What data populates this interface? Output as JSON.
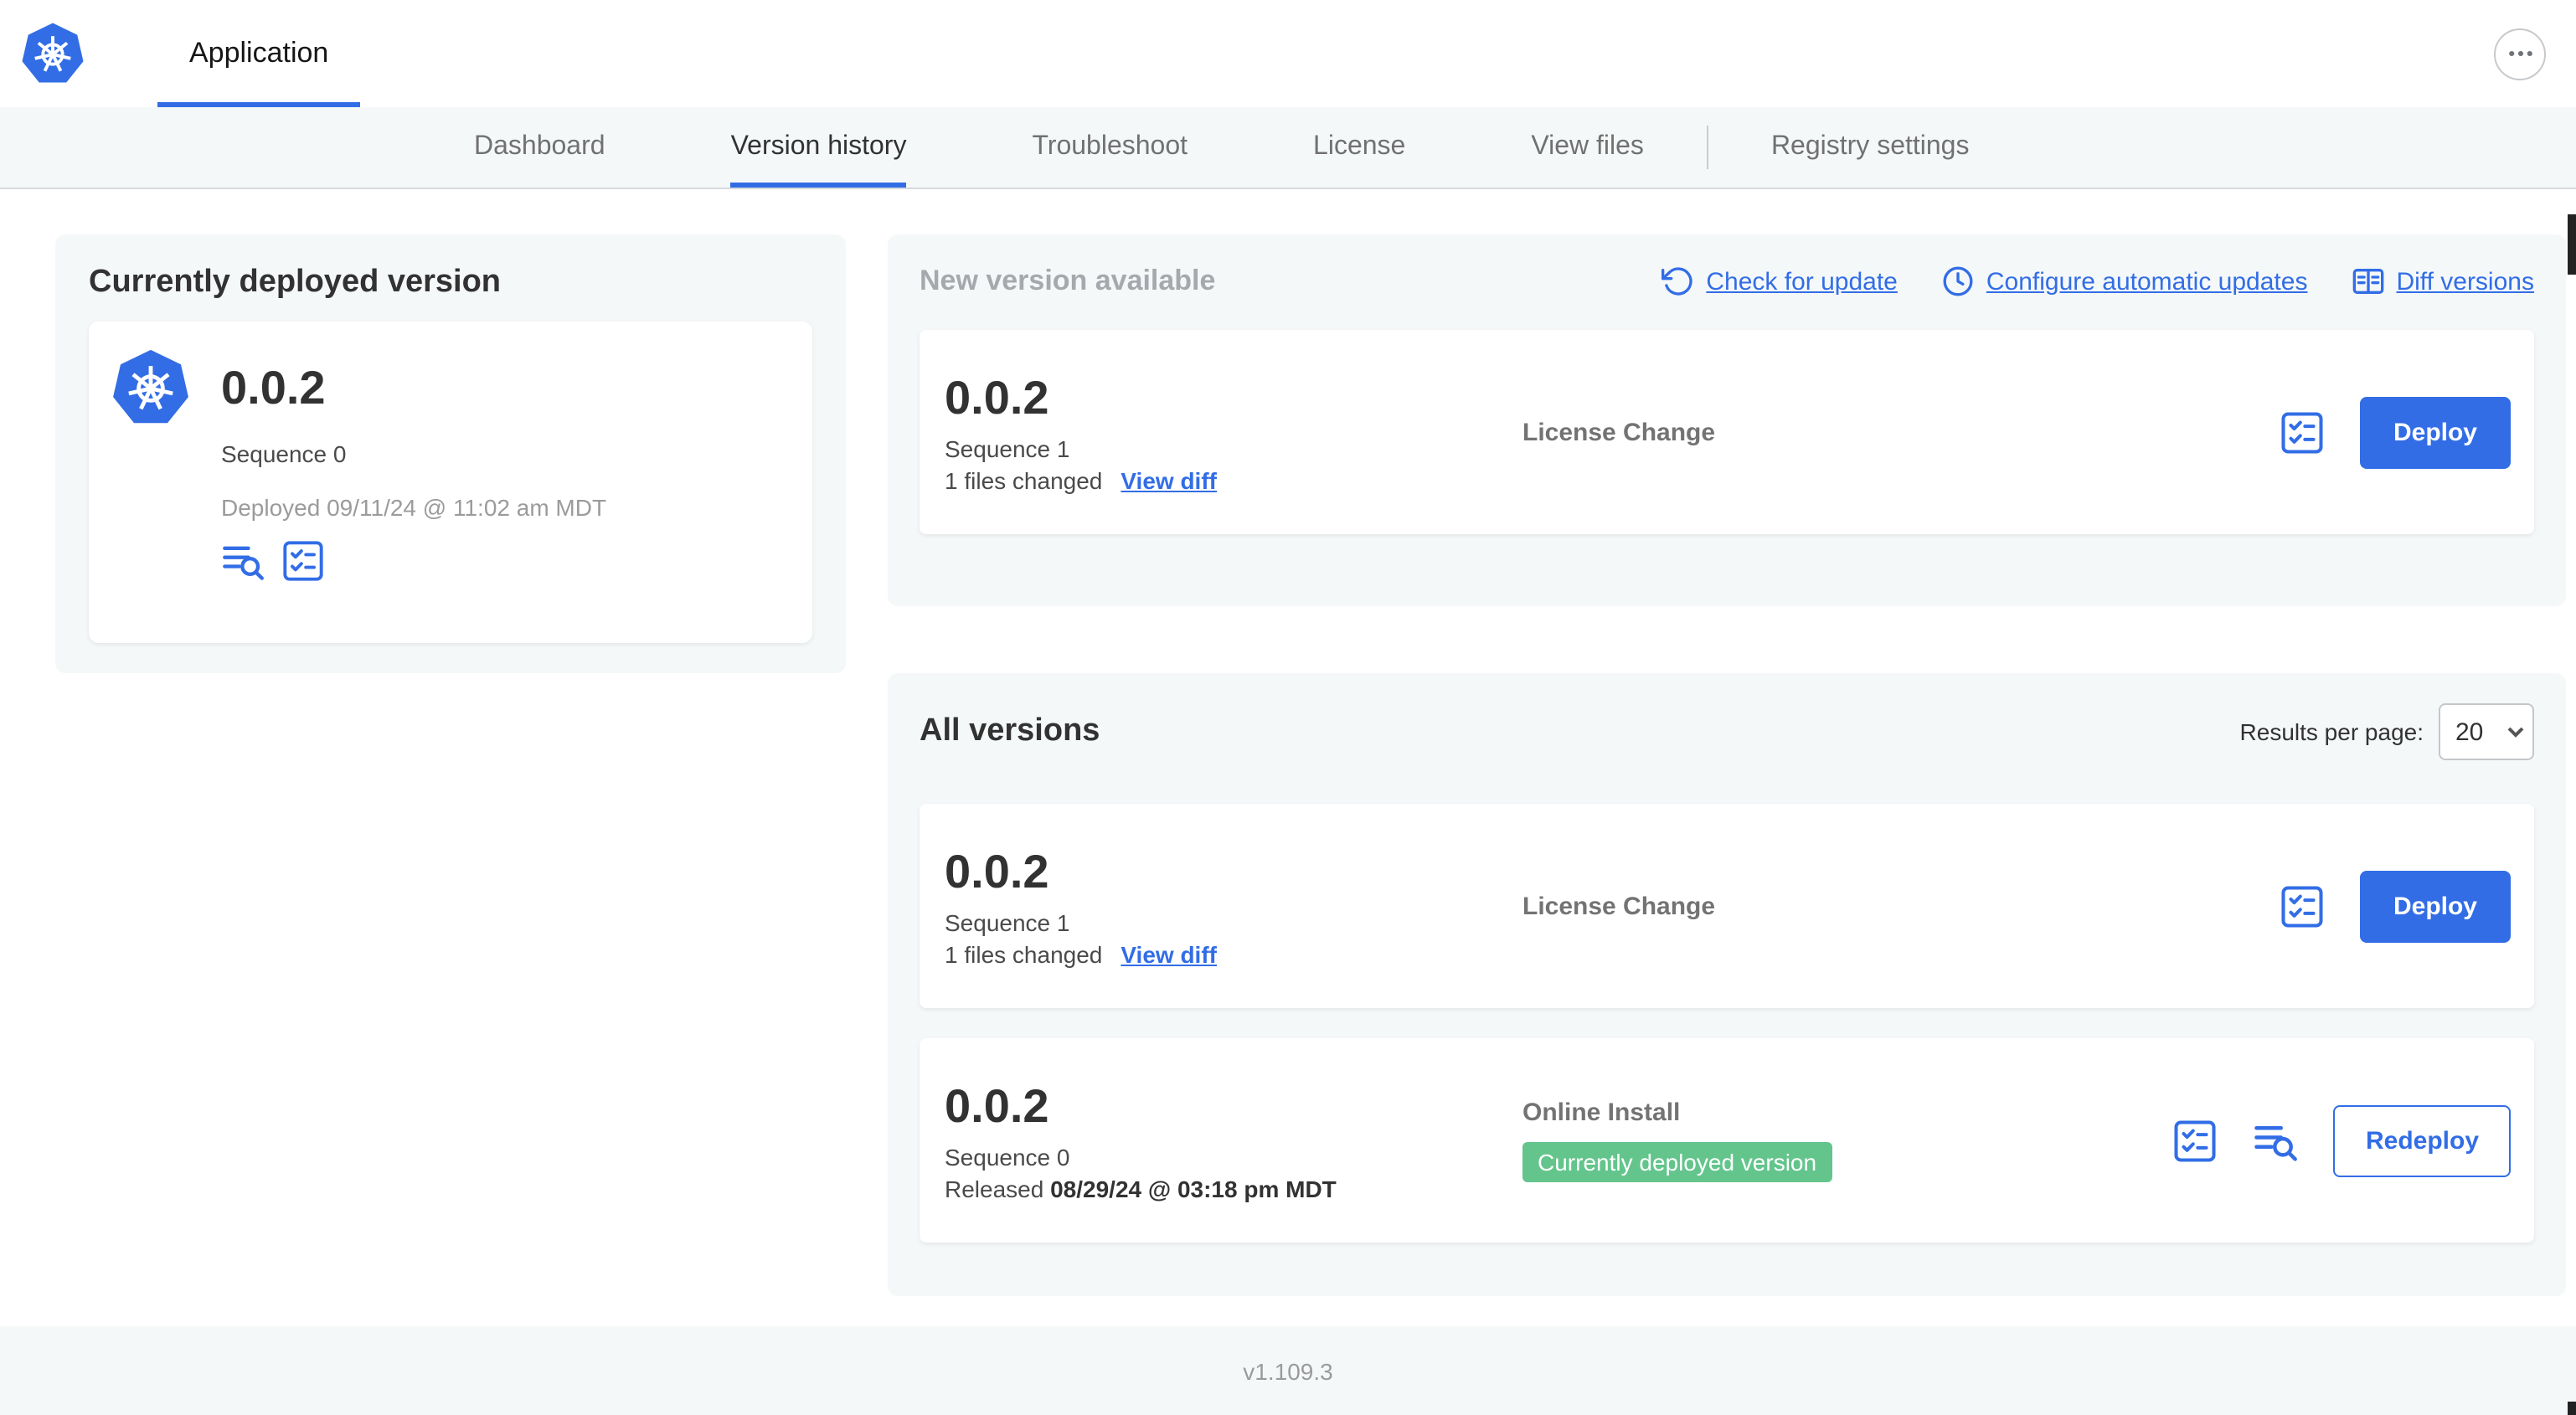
{
  "header": {
    "app_title": "Application"
  },
  "nav": {
    "tabs": [
      {
        "label": "Dashboard",
        "active": false
      },
      {
        "label": "Version history",
        "active": true
      },
      {
        "label": "Troubleshoot",
        "active": false
      },
      {
        "label": "License",
        "active": false
      },
      {
        "label": "View files",
        "active": false
      },
      {
        "label": "Registry settings",
        "active": false
      }
    ]
  },
  "current_version": {
    "title": "Currently deployed version",
    "version": "0.0.2",
    "sequence": "Sequence 0",
    "deployed_text": "Deployed 09/11/24 @ 11:02 am MDT"
  },
  "new_version": {
    "title": "New version available",
    "actions": {
      "check_for_update": "Check for update",
      "configure_automatic_updates": "Configure automatic updates",
      "diff_versions": "Diff versions"
    },
    "row": {
      "version": "0.0.2",
      "sequence": "Sequence 1",
      "files_changed": "1 files changed",
      "view_diff_label": "View diff",
      "source": "License Change",
      "deploy_label": "Deploy"
    }
  },
  "all_versions": {
    "title": "All versions",
    "results_per_page_label": "Results per page:",
    "results_per_page_value": "20",
    "rows": [
      {
        "version": "0.0.2",
        "sequence": "Sequence 1",
        "files_changed": "1 files changed",
        "view_diff_label": "View diff",
        "source": "License Change",
        "deploy_label": "Deploy"
      },
      {
        "version": "0.0.2",
        "sequence": "Sequence 0",
        "released_prefix": "Released",
        "released_date": "08/29/24 @ 03:18 pm MDT",
        "source": "Online Install",
        "badge_label": "Currently deployed version",
        "redeploy_label": "Redeploy"
      }
    ]
  },
  "footer": {
    "app_version": "v1.109.3"
  },
  "icons": {
    "kubernetes_logo": "blue heptagon with white helm wheel",
    "ellipsis": "three horizontal dots in circle",
    "refresh": "counter-clockwise circular arrow",
    "clock_refresh": "clock with circular arrow",
    "diff": "side-by-side diff panel",
    "checklist": "bordered square with checked list",
    "logs": "text lines with magnifier",
    "chevron_down": "downward chevron"
  },
  "colors": {
    "accent_blue": "#326de6",
    "badge_green": "#63c58c",
    "card_bg": "#f5f8f9",
    "muted_text": "#9b9b9b",
    "dark_text": "#323232"
  }
}
